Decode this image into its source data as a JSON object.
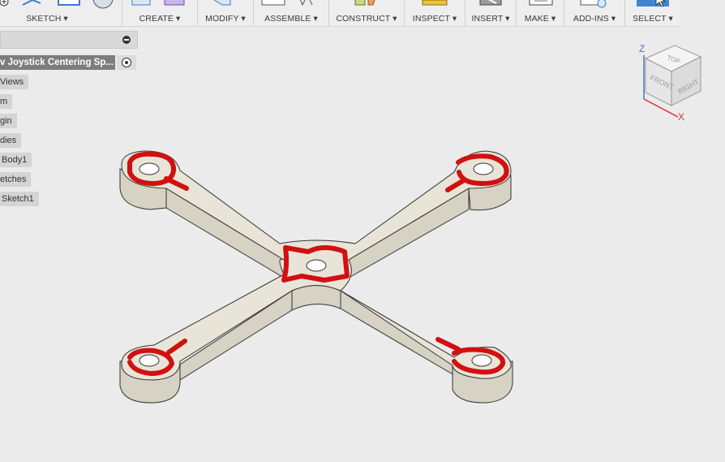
{
  "toolbar": {
    "groups": [
      {
        "label": "SKETCH ▾",
        "icon": "sketch-icon"
      },
      {
        "label": "CREATE ▾",
        "icon": "create-icon"
      },
      {
        "label": "MODIFY ▾",
        "icon": "modify-icon"
      },
      {
        "label": "ASSEMBLE ▾",
        "icon": "assemble-icon"
      },
      {
        "label": "CONSTRUCT ▾",
        "icon": "construct-icon"
      },
      {
        "label": "INSPECT ▾",
        "icon": "inspect-icon"
      },
      {
        "label": "INSERT ▾",
        "icon": "insert-icon"
      },
      {
        "label": "MAKE ▾",
        "icon": "make-icon"
      },
      {
        "label": "ADD-INS ▾",
        "icon": "addins-icon"
      },
      {
        "label": "SELECT ▾",
        "icon": "select-icon"
      }
    ]
  },
  "browser": {
    "document_title": "v Joystick Centering Sp...",
    "items": [
      "Views",
      "m",
      "gin",
      "dies",
      "Body1",
      "etches",
      "Sketch1"
    ]
  },
  "viewcube": {
    "top": "TOP",
    "front": "FRONT",
    "right": "RIGHT",
    "axis_z": "Z",
    "axis_x": "X"
  },
  "colors": {
    "toolbar_bg": "#eeeeee",
    "canvas_bg": "#ebebeb",
    "part_top": "#e8e4d8",
    "part_side": "#d6d2c4",
    "markup": "#d11010",
    "axis_x": "#e03030",
    "axis_z": "#5a6cc8"
  }
}
